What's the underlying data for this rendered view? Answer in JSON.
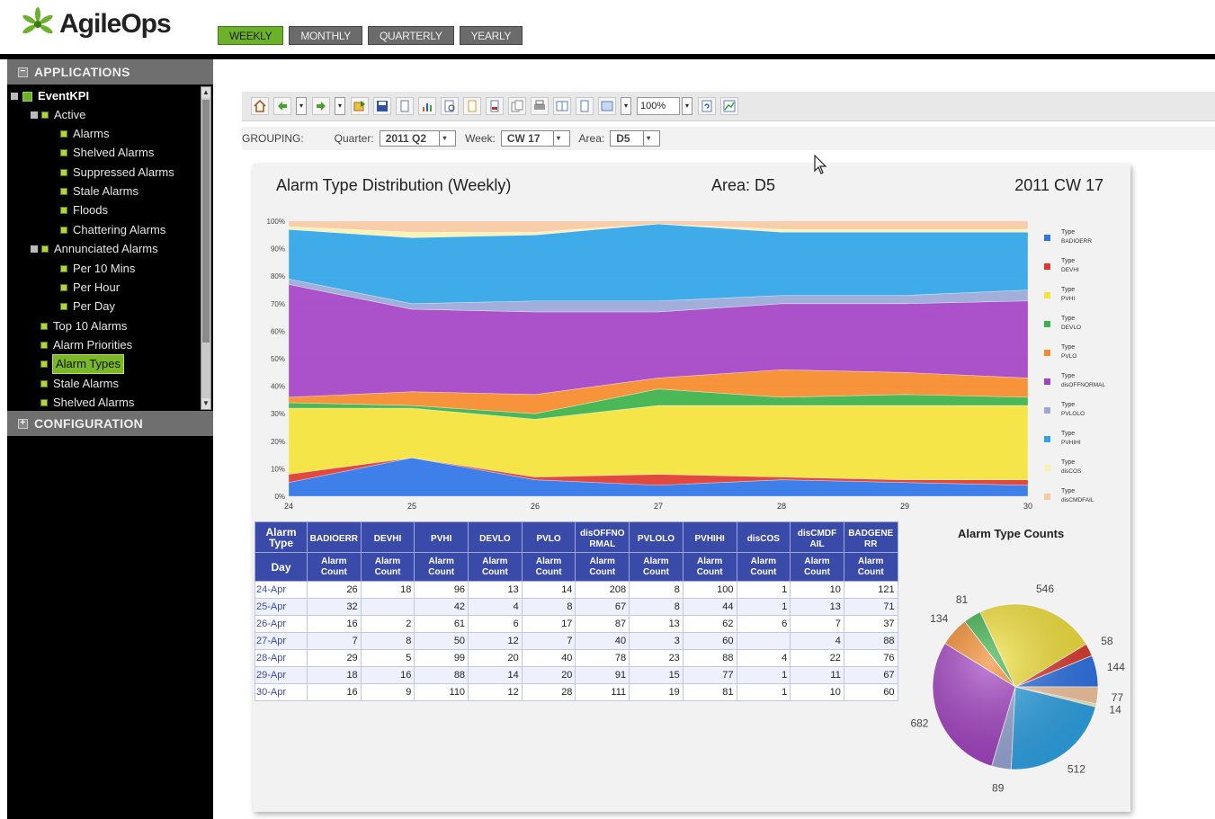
{
  "app": {
    "logo_text": "AgileOps"
  },
  "period_tabs": [
    {
      "label": "WEEKLY",
      "active": true
    },
    {
      "label": "MONTHLY",
      "active": false
    },
    {
      "label": "QUARTERLY",
      "active": false
    },
    {
      "label": "YEARLY",
      "active": false
    }
  ],
  "sidebar": {
    "applications_label": "APPLICATIONS",
    "configuration_label": "CONFIGURATION",
    "tree": {
      "root": "EventKPI",
      "active": "Active",
      "alarms": "Alarms",
      "shelved_alarms": "Shelved Alarms",
      "suppressed_alarms": "Suppressed Alarms",
      "stale_alarms": "Stale Alarms",
      "floods": "Floods",
      "chattering_alarms": "Chattering Alarms",
      "annunciated_alarms": "Annunciated Alarms",
      "per_10_mins": "Per 10 Mins",
      "per_hour": "Per Hour",
      "per_day": "Per Day",
      "top_10_alarms": "Top 10 Alarms",
      "alarm_priorities": "Alarm Priorities",
      "alarm_types": "Alarm Types",
      "stale_alarms_2": "Stale Alarms",
      "shelved_alarms_2": "Shelved Alarms"
    }
  },
  "toolbar": {
    "zoom": "100%",
    "icons": [
      "home-icon",
      "back-icon",
      "forward-icon",
      "export-icon",
      "save-icon",
      "document-icon",
      "chart-icon",
      "print-preview-icon",
      "page-icon",
      "pdf-icon",
      "copy-icon",
      "print-icon",
      "layout-icon",
      "find-icon",
      "view-icon",
      "refresh-icon",
      "chart-type-icon"
    ]
  },
  "grouping": {
    "label": "GROUPING:",
    "quarter_label": "Quarter:",
    "quarter_value": "2011 Q2",
    "week_label": "Week:",
    "week_value": "CW 17",
    "area_label": "Area:",
    "area_value": "D5"
  },
  "report": {
    "title": "Alarm Type Distribution (Weekly)",
    "area": "Area: D5",
    "week": "2011 CW 17"
  },
  "colors": {
    "accent_green": "#6cb12c",
    "table_header": "#3a4aa8"
  },
  "chart_data": [
    {
      "type": "area",
      "stacking": "percent",
      "x": [
        24,
        25,
        26,
        27,
        28,
        29,
        30
      ],
      "ytick_labels": [
        "0%",
        "10%",
        "20%",
        "30%",
        "40%",
        "50%",
        "60%",
        "70%",
        "80%",
        "90%",
        "100%"
      ],
      "ylim": [
        0,
        100
      ],
      "legend_placement": "right",
      "series": [
        {
          "name": "Type BADIOERR",
          "color": "#2f74e8",
          "values": [
            5,
            14,
            6,
            4,
            6,
            5,
            4
          ]
        },
        {
          "name": "Type DEVHI",
          "color": "#e03a2e",
          "values": [
            3,
            0,
            1,
            4,
            1,
            1,
            2
          ]
        },
        {
          "name": "Type PVHI",
          "color": "#f5e33a",
          "values": [
            24,
            18,
            21,
            25,
            26,
            27,
            27
          ]
        },
        {
          "name": "Type DEVLO",
          "color": "#3cb24a",
          "values": [
            2,
            1,
            2,
            6,
            3,
            4,
            3
          ]
        },
        {
          "name": "Type PVLO",
          "color": "#f58a2a",
          "values": [
            2,
            5,
            7,
            4,
            10,
            8,
            7
          ]
        },
        {
          "name": "Type disOFFNORMAL",
          "color": "#a442c4",
          "values": [
            41,
            30,
            30,
            24,
            24,
            25,
            28
          ]
        },
        {
          "name": "Type PVLOLO",
          "color": "#9aa8d8",
          "values": [
            2,
            2,
            4,
            4,
            3,
            3,
            4
          ]
        },
        {
          "name": "Type PVHIHI",
          "color": "#2fa4e6",
          "values": [
            18,
            24,
            24,
            28,
            23,
            23,
            21
          ]
        },
        {
          "name": "Type disCOS",
          "color": "#f7f2b0",
          "values": [
            1,
            2,
            1,
            0,
            1,
            1,
            1
          ]
        },
        {
          "name": "Type disCMDFAIL",
          "color": "#f7c9a2",
          "values": [
            2,
            4,
            4,
            1,
            3,
            3,
            3
          ]
        }
      ]
    },
    {
      "type": "table",
      "header_row1_first": "Alarm Type",
      "header_row2_first": "Day",
      "sub_header": "Alarm Count",
      "columns": [
        "BADIOERR",
        "DEVHI",
        "PVHI",
        "DEVLO",
        "PVLO",
        "disOFFNO RMAL",
        "PVLOLO",
        "PVHIHI",
        "disCOS",
        "disCMDF AIL",
        "BADGENE RR"
      ],
      "rows": [
        {
          "day": "24-Apr",
          "values": [
            "26",
            "18",
            "96",
            "13",
            "14",
            "208",
            "8",
            "100",
            "1",
            "10",
            "121"
          ]
        },
        {
          "day": "25-Apr",
          "values": [
            "32",
            "",
            "42",
            "4",
            "8",
            "67",
            "8",
            "44",
            "1",
            "13",
            "71"
          ]
        },
        {
          "day": "26-Apr",
          "values": [
            "16",
            "2",
            "61",
            "6",
            "17",
            "87",
            "13",
            "62",
            "6",
            "7",
            "37"
          ]
        },
        {
          "day": "27-Apr",
          "values": [
            "7",
            "8",
            "50",
            "12",
            "7",
            "40",
            "3",
            "60",
            "",
            "4",
            "88"
          ]
        },
        {
          "day": "28-Apr",
          "values": [
            "29",
            "5",
            "99",
            "20",
            "40",
            "78",
            "23",
            "88",
            "4",
            "22",
            "76"
          ]
        },
        {
          "day": "29-Apr",
          "values": [
            "18",
            "16",
            "88",
            "14",
            "20",
            "91",
            "15",
            "77",
            "1",
            "11",
            "67"
          ]
        },
        {
          "day": "30-Apr",
          "values": [
            "16",
            "9",
            "110",
            "12",
            "28",
            "111",
            "19",
            "81",
            "1",
            "10",
            "60"
          ]
        }
      ]
    },
    {
      "type": "pie",
      "title": "Alarm Type Counts",
      "slices": [
        {
          "value": 144,
          "label": "144",
          "color": "#2f74e8"
        },
        {
          "value": 58,
          "label": "58",
          "color": "#e03a2e"
        },
        {
          "value": 546,
          "label": "546",
          "color": "#f5e33a"
        },
        {
          "value": 81,
          "label": "81",
          "color": "#3cb24a"
        },
        {
          "value": 134,
          "label": "134",
          "color": "#f58a2a"
        },
        {
          "value": 682,
          "label": "682",
          "color": "#a442c4"
        },
        {
          "value": 89,
          "label": "89",
          "color": "#9aa8d8"
        },
        {
          "value": 512,
          "label": "512",
          "color": "#2fa4e6"
        },
        {
          "value": 14,
          "label": "14",
          "color": "#f7f2b0"
        },
        {
          "value": 77,
          "label": "77",
          "color": "#f7c9a2"
        }
      ]
    }
  ]
}
